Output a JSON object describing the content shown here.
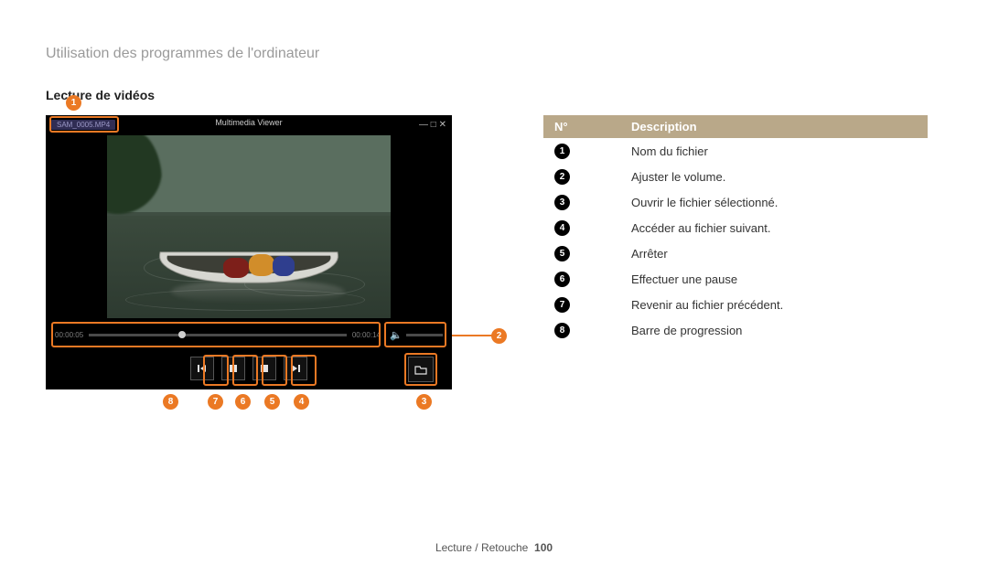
{
  "section_title": "Utilisation des programmes de l'ordinateur",
  "subsection_title": "Lecture de vidéos",
  "viewer": {
    "app_title": "Multimedia Viewer",
    "file_name": "SAM_0005.MP4",
    "time_current": "00:00:05",
    "time_total": "00:00:14",
    "window_controls": "— □ ✕"
  },
  "callouts": [
    {
      "n": "1",
      "desc": "Nom du fichier"
    },
    {
      "n": "2",
      "desc": "Ajuster le volume."
    },
    {
      "n": "3",
      "desc": "Ouvrir le fichier sélectionné."
    },
    {
      "n": "4",
      "desc": "Accéder au fichier suivant."
    },
    {
      "n": "5",
      "desc": "Arrêter"
    },
    {
      "n": "6",
      "desc": "Effectuer une pause"
    },
    {
      "n": "7",
      "desc": "Revenir au fichier précédent."
    },
    {
      "n": "8",
      "desc": "Barre de progression"
    }
  ],
  "table_header": {
    "num": "N°",
    "desc": "Description"
  },
  "footer": {
    "section": "Lecture / Retouche",
    "page": "100"
  }
}
